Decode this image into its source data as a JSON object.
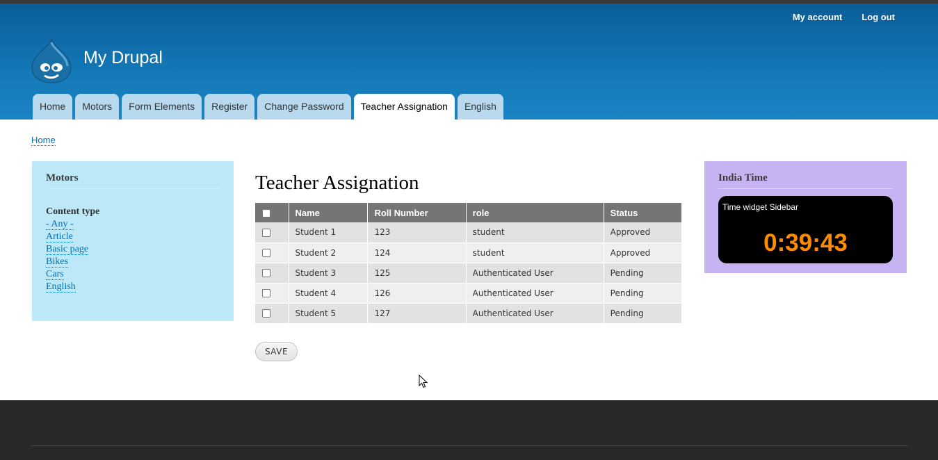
{
  "header": {
    "site_name": "My Drupal",
    "secondary_menu": [
      "My account",
      "Log out"
    ],
    "logo_icon": "drupal-drop-icon",
    "background_color": "#0a5c96"
  },
  "tabs": [
    {
      "label": "Home",
      "active": false
    },
    {
      "label": "Motors",
      "active": false
    },
    {
      "label": "Form Elements",
      "active": false
    },
    {
      "label": "Register",
      "active": false
    },
    {
      "label": "Change Password",
      "active": false
    },
    {
      "label": "Teacher Assignation",
      "active": true
    },
    {
      "label": "English",
      "active": false
    }
  ],
  "breadcrumb": {
    "home": "Home"
  },
  "sidebar_first": {
    "title": "Motors",
    "facet_label": "Content type",
    "facet_items": [
      "- Any -",
      "Article",
      "Basic page",
      "Bikes",
      "Cars",
      "English"
    ],
    "background_color": "#bde8f7"
  },
  "main": {
    "title": "Teacher Assignation",
    "table": {
      "headers": [
        "Name",
        "Roll Number",
        "role",
        "Status"
      ],
      "rows": [
        {
          "name": "Student 1",
          "roll": "123",
          "role": "student",
          "status": "Approved"
        },
        {
          "name": "Student 2",
          "roll": "124",
          "role": "student",
          "status": "Approved"
        },
        {
          "name": "Student 3",
          "roll": "125",
          "role": "Authenticated User",
          "status": "Pending"
        },
        {
          "name": "Student 4",
          "roll": "126",
          "role": "Authenticated User",
          "status": "Pending"
        },
        {
          "name": "Student 5",
          "roll": "127",
          "role": "Authenticated User",
          "status": "Pending"
        }
      ]
    },
    "save_label": "SAVE"
  },
  "sidebar_second": {
    "title": "India Time",
    "widget_title": "Time widget Sidebar",
    "clock": "0:39:43",
    "clock_color": "#ff8c00",
    "background_color": "#c7b3f2"
  }
}
